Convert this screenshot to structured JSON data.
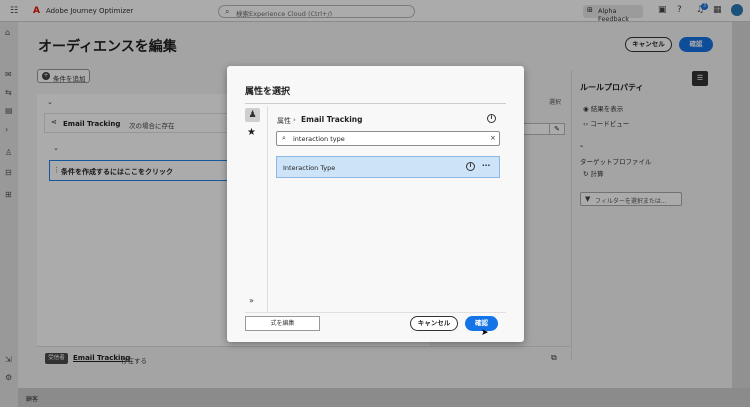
{
  "app": {
    "name": "Adobe Journey Optimizer",
    "search_placeholder": "検索Experience Cloud (Ctrl+/)",
    "feedback_label": "Alpha Feedback",
    "notification_count": "3",
    "icons": [
      "app-grid-icon",
      "adobe-logo-icon",
      "search-icon",
      "feedback-icon",
      "inbox-icon",
      "help-icon",
      "bell-icon",
      "apps-icon",
      "avatar"
    ]
  },
  "editor": {
    "title": "オーディエンスを編集",
    "cancel_label": "キャンセル",
    "confirm_label": "確認",
    "add_condition_label": "条件を追加",
    "condition1": {
      "name": "Email Tracking",
      "text": "次の場合に存在"
    },
    "condition2": {
      "text": "条件を作成するにはここをクリック"
    },
    "background_select_label": "選択",
    "footer": {
      "tag": "受信者",
      "link": "Email Tracking",
      "suffix": "存在する"
    }
  },
  "rule_properties": {
    "title": "ルールプロパティ",
    "show_results": "結果を表示",
    "code_view": "コードビュー",
    "dash": "–",
    "target_profiles": "ターゲットプロファイル",
    "calculate": "計算",
    "filter_placeholder": "フィルターを選択または..."
  },
  "modal": {
    "title": "属性を選択",
    "breadcrumb_root": "属性",
    "breadcrumb_sep": "›",
    "breadcrumb_current": "Email Tracking",
    "search_value": "interaction type",
    "results": [
      {
        "label": "Interaction Type"
      }
    ],
    "edit_expression_label": "式を編集",
    "cancel_label": "キャンセル",
    "confirm_label": "確認",
    "expand_glyph": "»"
  },
  "bottom_bar": {
    "label": "顧客"
  },
  "colors": {
    "accent": "#1473e6",
    "adobe_red": "#eb1000",
    "selection": "#cde3f7"
  }
}
